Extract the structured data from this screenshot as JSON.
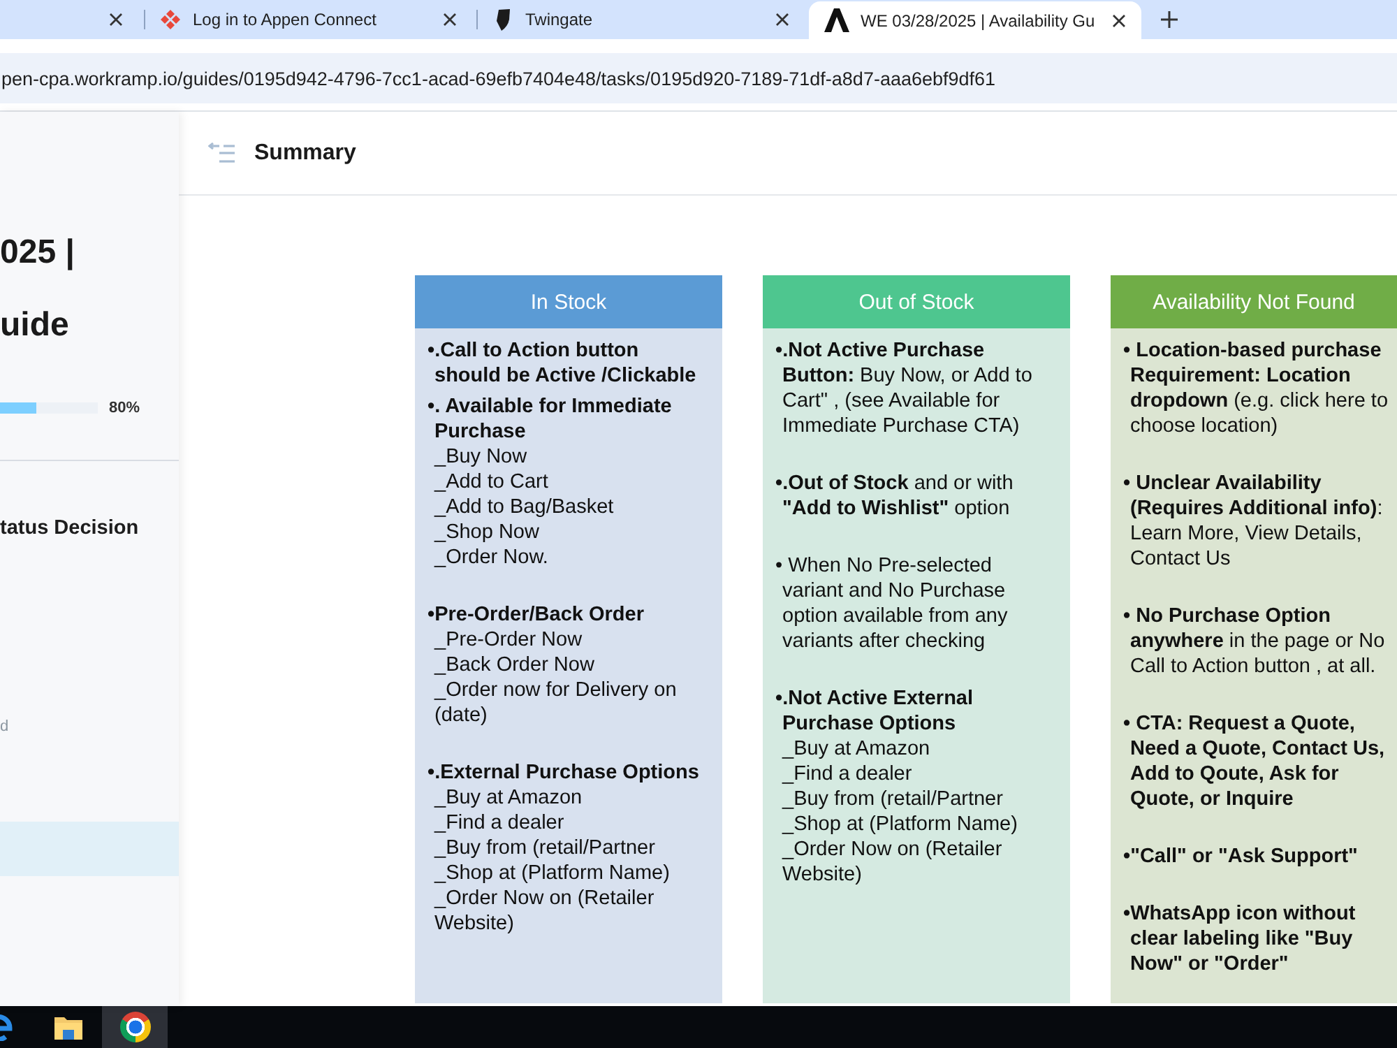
{
  "browser": {
    "tabs": [
      {
        "selected": false
      },
      {
        "title": "Log in to Appen Connect",
        "selected": false
      },
      {
        "title": "Twingate",
        "selected": false
      },
      {
        "title": "WE 03/28/2025 | Availability Gu",
        "selected": true
      }
    ],
    "url": "pen-cpa.workramp.io/guides/0195d942-4796-7cc1-acad-69efb7404e48/tasks/0195d920-7189-71df-a8d7-aaa6ebf9df61"
  },
  "sidebar": {
    "title_lines": [
      "025 |",
      "uide"
    ],
    "progress": {
      "level": 0.8,
      "reading": "80%"
    },
    "section_title": "tatus Decision",
    "caption": "d",
    "items": [
      {
        "selected": true
      }
    ]
  },
  "header": {
    "title": "Summary"
  },
  "table": {
    "columns": [
      {
        "heading": "In Stock",
        "color": "#5b9bd5",
        "sections": [
          [
            {
              "kind": "heading",
              "text": "•.Call to Action button should be Active /Clickable"
            },
            {
              "kind": "heading",
              "text": "•. Available for Immediate Purchase",
              "items": [
                "_Buy Now",
                "_Add to Cart",
                "_Add to Bag/Basket",
                "_Shop Now",
                "_Order Now."
              ]
            }
          ],
          [
            {
              "kind": "heading",
              "text": "•Pre-Order/Back Order",
              "items": [
                "_Pre-Order Now",
                "_Back Order Now",
                "_Order now for Delivery on (date)"
              ]
            }
          ],
          [
            {
              "kind": "heading",
              "text": "•.External Purchase Options",
              "items": [
                "_Buy at Amazon",
                "_Find a dealer",
                "_Buy from (retail/Partner",
                "_Shop at (Platform Name)",
                "_Order Now on (Retailer Website)"
              ]
            }
          ]
        ]
      },
      {
        "heading": "Out of Stock",
        "color": "#4ec68f",
        "sections": [
          [
            {
              "kind": "plain",
              "text": "**•.Not Active Purchase Button:** Buy Now, or Add to Cart\" , (see Available for Immediate Purchase CTA)"
            }
          ],
          [
            {
              "kind": "plain",
              "text": "**•.Out of Stock** and or with **\"Add to Wishlist\"** option"
            }
          ],
          [
            {
              "kind": "plain",
              "text": "• When No Pre-selected variant and No Purchase option available from any variants after checking"
            }
          ],
          [
            {
              "kind": "heading",
              "text": "•.Not Active External Purchase Options",
              "items": [
                "_Buy at Amazon",
                "_Find a dealer",
                "_Buy from (retail/Partner",
                "_Shop at (Platform Name)",
                "_Order Now on (Retailer Website)"
              ]
            }
          ]
        ]
      },
      {
        "heading": "Availability Not Found",
        "color": "#70ad47",
        "sections": [
          [
            {
              "kind": "plain",
              "text": "**• Location-based purchase Requirement: Location dropdown** (e.g. click here to choose location)"
            }
          ],
          [
            {
              "kind": "plain",
              "text": "**• Unclear Availability (Requires Additional info)**: Learn More, View Details, Contact Us"
            }
          ],
          [
            {
              "kind": "plain",
              "text": "**• No Purchase Option anywhere** in the page or No Call to Action button , at all."
            }
          ],
          [
            {
              "kind": "heading",
              "text": "• CTA: Request a Quote, Need a Quote, Contact Us, Add to Qoute, Ask for Quote, or Inquire"
            }
          ],
          [
            {
              "kind": "heading",
              "text": "•\"Call\" or \"Ask Support\""
            }
          ],
          [
            {
              "kind": "heading",
              "text": "•WhatsApp icon without clear labeling like \"Buy Now\" or \"Order\""
            }
          ]
        ]
      }
    ]
  }
}
